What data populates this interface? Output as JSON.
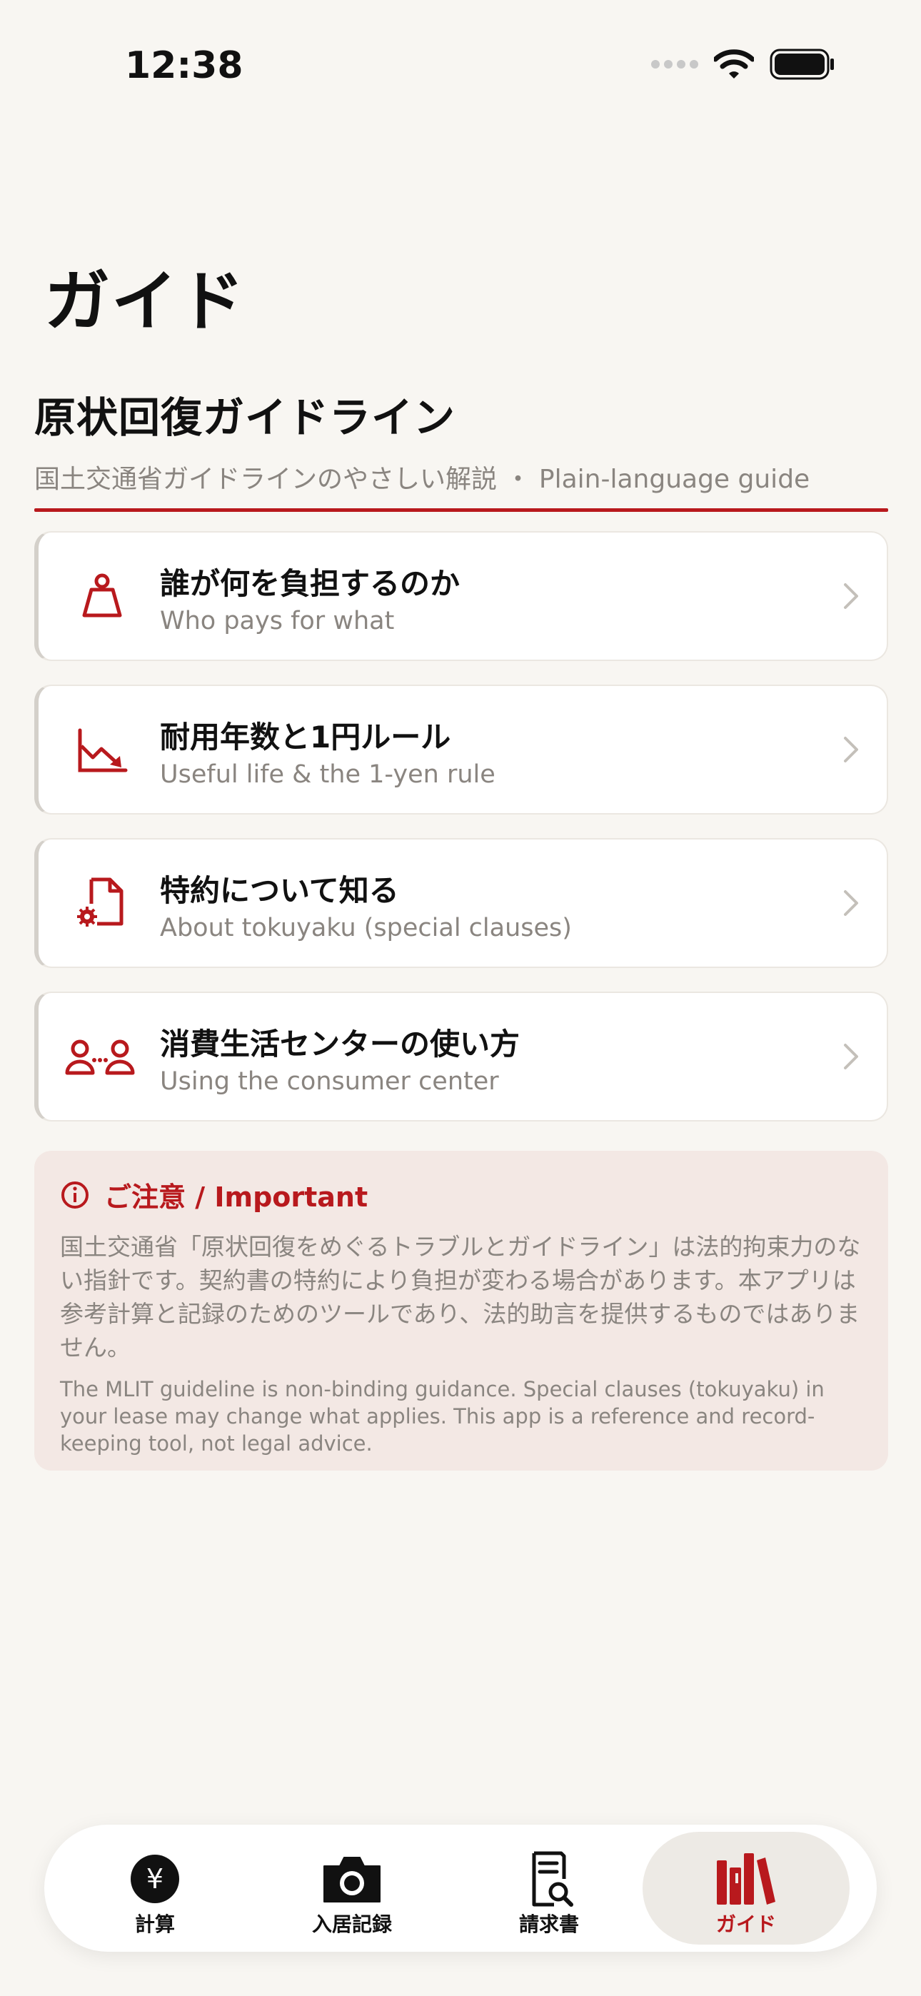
{
  "status_bar": {
    "time": "12:38"
  },
  "page": {
    "title": "ガイド"
  },
  "section": {
    "title": "原状回復ガイドライン",
    "subtitle": "国土交通省ガイドラインのやさしい解説 ・ Plain-language guide"
  },
  "guides": [
    {
      "title": "誰が何を負担するのか",
      "subtitle": "Who pays for what",
      "icon": "scale-weight-icon"
    },
    {
      "title": "耐用年数と1円ルール",
      "subtitle": "Useful life & the 1-yen rule",
      "icon": "depreciation-chart-icon"
    },
    {
      "title": "特約について知る",
      "subtitle": "About tokuyaku (special clauses)",
      "icon": "document-gear-icon"
    },
    {
      "title": "消費生活センターの使い方",
      "subtitle": "Using the consumer center",
      "icon": "people-consult-icon"
    }
  ],
  "notice": {
    "title": "ご注意 / Important",
    "body_ja": "国土交通省「原状回復をめぐるトラブルとガイドライン」は法的拘束力のない指針です。契約書の特約により負担が変わる場合があります。本アプリは参考計算と記録のためのツールであり、法的助言を提供するものではありません。",
    "body_en": "The MLIT guideline is non-binding guidance. Special clauses (tokuyaku) in your lease may change what applies. This app is a reference and record-keeping tool, not legal advice."
  },
  "tabs": [
    {
      "label": "計算",
      "icon": "yen-coin-icon",
      "active": false
    },
    {
      "label": "入居記録",
      "icon": "camera-icon",
      "active": false
    },
    {
      "label": "請求書",
      "icon": "document-search-icon",
      "active": false
    },
    {
      "label": "ガイド",
      "icon": "books-icon",
      "active": true
    }
  ],
  "colors": {
    "accent": "#b8191d",
    "background": "#f8f6f2",
    "card": "#ffffff",
    "notice_bg": "#f3e8e4",
    "muted_text": "#8a8580"
  }
}
